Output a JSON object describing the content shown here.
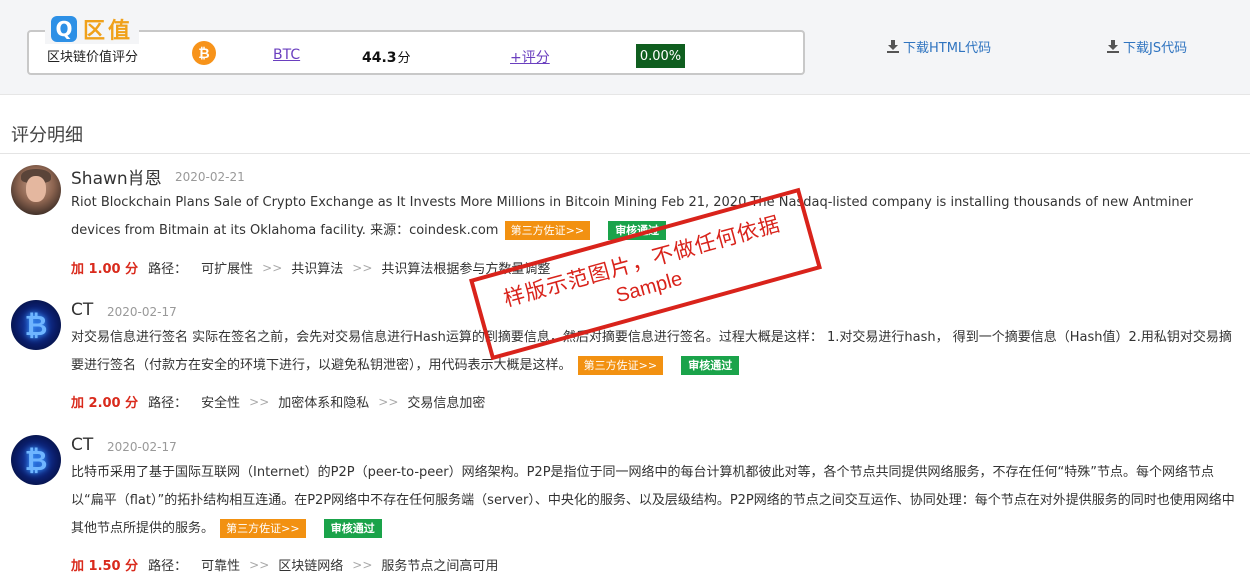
{
  "header": {
    "logo_badge": "Q",
    "logo_text": "区值",
    "label": "区块链价值评分",
    "coin_icon": "bitcoin-icon",
    "coin_symbol": "BTC",
    "score": "44.3",
    "score_unit": "分",
    "rate_link": "+评分",
    "change": "0.00%",
    "download_html": "下载HTML代码",
    "download_js": "下载JS代码",
    "colors": {
      "logo_badge": "#2d90e6",
      "logo_text": "#f0a11b",
      "change_bg": "#0f5e1f",
      "link": "#2f74c0"
    }
  },
  "section": {
    "title": "评分明细"
  },
  "reviews": [
    {
      "author": "Shawn肖恩",
      "date": "2020-02-21",
      "avatar": "user-photo",
      "content": "Riot Blockchain Plans Sale of Crypto Exchange as It Invests More Millions in Bitcoin Mining Feb 21, 2020 The Nasdaq-listed company is installing thousands of new Antminer devices from Bitmain at its Oklahoma facility. 来源：coindesk.com",
      "tag_third": "第三方佐证>>",
      "tag_ok": "审核通过",
      "points": "加 1.00 分",
      "path_label": "路径：",
      "path": [
        "可扩展性",
        "共识算法",
        "共识算法根据参与方数量调整"
      ]
    },
    {
      "author": "CT",
      "date": "2020-02-17",
      "avatar": "bitcoin-avatar",
      "content": "对交易信息进行签名 实际在签名之前，会先对交易信息进行Hash运算的到摘要信息，然后对摘要信息进行签名。过程大概是这样： 1.对交易进行hash， 得到一个摘要信息（Hash值）2.用私钥对交易摘要进行签名（付款方在安全的环境下进行，以避免私钥泄密），用代码表示大概是这样。",
      "tag_third": "第三方佐证>>",
      "tag_ok": "审核通过",
      "points": "加 2.00 分",
      "path_label": "路径：",
      "path": [
        "安全性",
        "加密体系和隐私",
        "交易信息加密"
      ]
    },
    {
      "author": "CT",
      "date": "2020-02-17",
      "avatar": "bitcoin-avatar",
      "content": "比特币采用了基于国际互联网（Internet）的P2P（peer-to-peer）网络架构。P2P是指位于同一网络中的每台计算机都彼此对等，各个节点共同提供网络服务，不存在任何“特殊”节点。每个网络节点以“扁平（flat）”的拓扑结构相互连通。在P2P网络中不存在任何服务端（server）、中央化的服务、以及层级结构。P2P网络的节点之间交互运作、协同处理：每个节点在对外提供服务的同时也使用网络中其他节点所提供的服务。",
      "tag_third": "第三方佐证>>",
      "tag_ok": "审核通过",
      "points": "加 1.50 分",
      "path_label": "路径：",
      "path": [
        "可靠性",
        "区块链网络",
        "服务节点之间高可用"
      ]
    }
  ],
  "stamp": {
    "line1": "样版示范图片，不做任何依据",
    "line2": "Sample",
    "color": "#d9231b"
  }
}
